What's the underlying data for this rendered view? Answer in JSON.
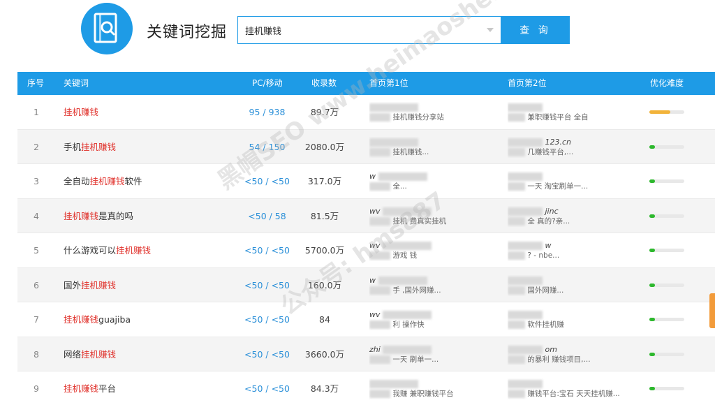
{
  "header": {
    "title": "关键词挖掘",
    "search_value": "挂机赚钱",
    "search_button": "查 询"
  },
  "table": {
    "columns": [
      "序号",
      "关键词",
      "PC/移动",
      "收录数",
      "首页第1位",
      "首页第2位",
      "优化难度"
    ],
    "rows": [
      {
        "idx": "1",
        "pre": "",
        "hl": "挂机赚钱",
        "post": "",
        "pc": "95 / 938",
        "count": "89.7万",
        "r1_url": "",
        "r1_desc": "挂机赚钱分享站",
        "r2_url": "",
        "r2_desc": "兼职赚钱平台 全自",
        "difficulty": 0.6,
        "diff_color": "#f2b33a"
      },
      {
        "idx": "2",
        "pre": "手机",
        "hl": "挂机赚钱",
        "post": "",
        "pc": "54 / 150",
        "count": "2080.0万",
        "r1_url": "",
        "r1_desc": "挂机赚钱...",
        "r2_url": "123.cn",
        "r2_desc": "几赚钱平台,...",
        "difficulty": 0.15,
        "diff_color": "#2db82d"
      },
      {
        "idx": "3",
        "pre": "全自动",
        "hl": "挂机赚钱",
        "post": "软件",
        "pc": "<50 / <50",
        "count": "317.0万",
        "r1_url": "w",
        "r1_desc": "全...",
        "r2_url": "",
        "r2_desc": "一天 淘宝刷单一...",
        "difficulty": 0.15,
        "diff_color": "#2db82d"
      },
      {
        "idx": "4",
        "pre": "",
        "hl": "挂机赚钱",
        "post": "是真的吗",
        "pc": "<50 / 58",
        "count": "81.5万",
        "r1_url": "wv",
        "r1_desc": "挂机 费真实挂机",
        "r2_url": "jinc",
        "r2_desc": "全 真的?亲...",
        "difficulty": 0.15,
        "diff_color": "#2db82d"
      },
      {
        "idx": "5",
        "pre": "什么游戏可以",
        "hl": "挂机赚钱",
        "post": "",
        "pc": "<50 / <50",
        "count": "5700.0万",
        "r1_url": "wv",
        "r1_desc": "游戏 钱",
        "r2_url": "w",
        "r2_desc": "? - nbe...",
        "difficulty": 0.15,
        "diff_color": "#2db82d"
      },
      {
        "idx": "6",
        "pre": "国外",
        "hl": "挂机赚钱",
        "post": "",
        "pc": "<50 / <50",
        "count": "160.0万",
        "r1_url": "w",
        "r1_desc": "手 ,国外网赚...",
        "r2_url": "",
        "r2_desc": "国外网赚...",
        "difficulty": 0.15,
        "diff_color": "#2db82d"
      },
      {
        "idx": "7",
        "pre": "",
        "hl": "挂机赚钱",
        "post": "guajiba",
        "pc": "<50 / <50",
        "count": "84",
        "r1_url": "wv",
        "r1_desc": "利 操作快",
        "r2_url": "",
        "r2_desc": "软件挂机赚",
        "difficulty": 0.15,
        "diff_color": "#2db82d"
      },
      {
        "idx": "8",
        "pre": "网络",
        "hl": "挂机赚钱",
        "post": "",
        "pc": "<50 / <50",
        "count": "3660.0万",
        "r1_url": "zhi",
        "r1_desc": "一天 刷单一...",
        "r2_url": "om",
        "r2_desc": "的暴利 赚钱项目,...",
        "difficulty": 0.15,
        "diff_color": "#2db82d"
      },
      {
        "idx": "9",
        "pre": "",
        "hl": "挂机赚钱",
        "post": "平台",
        "pc": "<50 / <50",
        "count": "84.3万",
        "r1_url": "",
        "r1_desc": "我赚 兼职赚钱平台",
        "r2_url": "",
        "r2_desc": "赚钱平台:宝石 天天挂机赚...",
        "difficulty": 0.15,
        "diff_color": "#2db82d"
      }
    ]
  },
  "colors": {
    "accent": "#1e9be6",
    "highlight": "#e0302a"
  },
  "watermark": {
    "line1": "黑帽SEO www.heimaoshe.com",
    "line2": "公众号: hms887"
  }
}
